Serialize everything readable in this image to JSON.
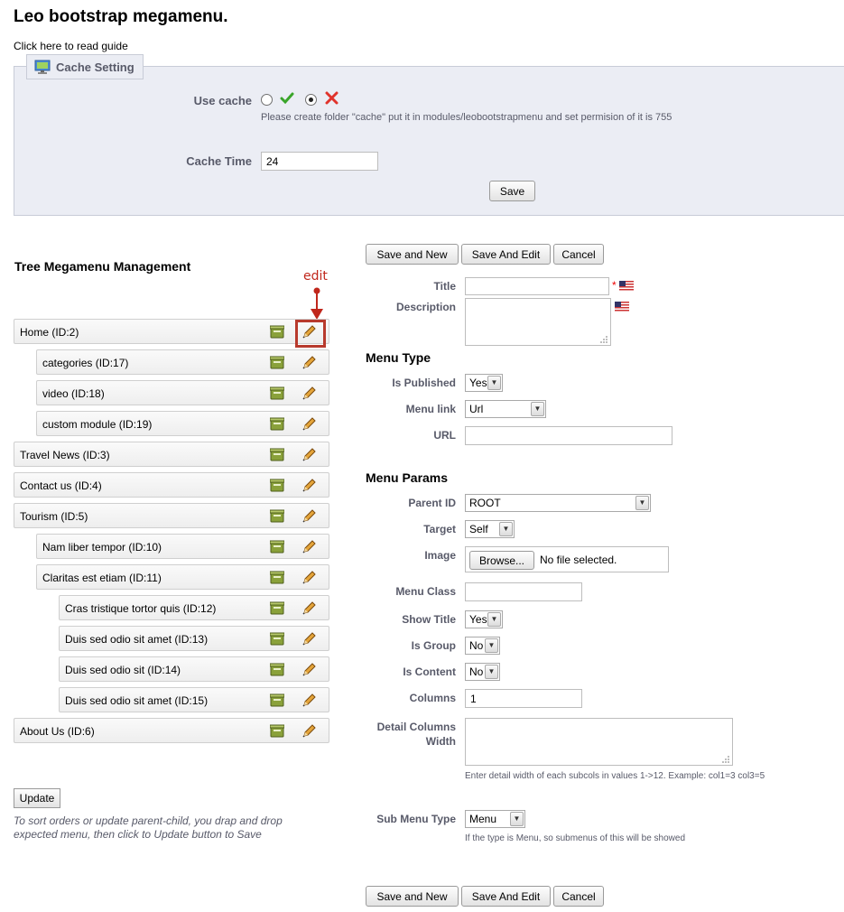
{
  "page": {
    "title": "Leo bootstrap megamenu.",
    "guide_link": "Click here to read guide"
  },
  "cache": {
    "legend": "Cache Setting",
    "use_cache_label": "Use cache",
    "use_cache_value": "no",
    "use_cache_hint": "Please create folder \"cache\" put it in modules/leobootstrapmenu and set permision of it is 755",
    "cache_time_label": "Cache Time",
    "cache_time_value": "24",
    "save_label": "Save"
  },
  "tree": {
    "title": "Tree Megamenu Management",
    "callout": "edit",
    "items": [
      {
        "label": "Home (ID:2)",
        "level": 0
      },
      {
        "label": "categories (ID:17)",
        "level": 1
      },
      {
        "label": "video (ID:18)",
        "level": 1
      },
      {
        "label": "custom module (ID:19)",
        "level": 1
      },
      {
        "label": "Travel News (ID:3)",
        "level": 0
      },
      {
        "label": "Contact us (ID:4)",
        "level": 0
      },
      {
        "label": "Tourism (ID:5)",
        "level": 0
      },
      {
        "label": "Nam liber tempor (ID:10)",
        "level": 1
      },
      {
        "label": "Claritas est etiam (ID:11)",
        "level": 1
      },
      {
        "label": "Cras tristique tortor quis (ID:12)",
        "level": 2
      },
      {
        "label": "Duis sed odio sit amet (ID:13)",
        "level": 2
      },
      {
        "label": "Duis sed odio sit (ID:14)",
        "level": 2
      },
      {
        "label": "Duis sed odio sit amet (ID:15)",
        "level": 2
      },
      {
        "label": "About Us (ID:6)",
        "level": 0
      }
    ],
    "update_label": "Update",
    "note": "To sort orders or update parent-child, you drap and drop expected menu, then click to Update button to Save"
  },
  "form": {
    "buttons": {
      "save_new": "Save and New",
      "save_edit": "Save And Edit",
      "cancel": "Cancel"
    },
    "title_label": "Title",
    "title_value": "",
    "required_mark": "*",
    "description_label": "Description",
    "menu_type_heading": "Menu Type",
    "is_published_label": "Is Published",
    "is_published_value": "Yes",
    "menu_link_label": "Menu link",
    "menu_link_value": "Url",
    "url_label": "URL",
    "url_value": "",
    "menu_params_heading": "Menu Params",
    "parent_id_label": "Parent ID",
    "parent_id_value": "ROOT",
    "target_label": "Target",
    "target_value": "Self",
    "image_label": "Image",
    "browse_label": "Browse...",
    "no_file_label": "No file selected.",
    "menu_class_label": "Menu Class",
    "menu_class_value": "",
    "show_title_label": "Show Title",
    "show_title_value": "Yes",
    "is_group_label": "Is Group",
    "is_group_value": "No",
    "is_content_label": "Is Content",
    "is_content_value": "No",
    "columns_label": "Columns",
    "columns_value": "1",
    "detail_columns_label_1": "Detail Columns",
    "detail_columns_label_2": "Width",
    "detail_columns_hint": "Enter detail width of each subcols in values 1->12. Example: col1=3 col3=5",
    "sub_menu_type_label": "Sub Menu Type",
    "sub_menu_type_value": "Menu",
    "sub_menu_type_hint": "If the type is Menu, so submenus of this will be showed"
  },
  "colors": {
    "panel_bg": "#ebedf4",
    "label_text": "#585a69",
    "highlight": "#b83a2d",
    "check_green": "#3aa52a",
    "cross_red": "#e0332b"
  },
  "icons": {
    "legend": "settings-monitor-icon",
    "check": "check-icon",
    "cross": "cross-icon",
    "delete": "trash-icon",
    "edit": "pencil-icon",
    "flag": "us-flag-icon"
  }
}
